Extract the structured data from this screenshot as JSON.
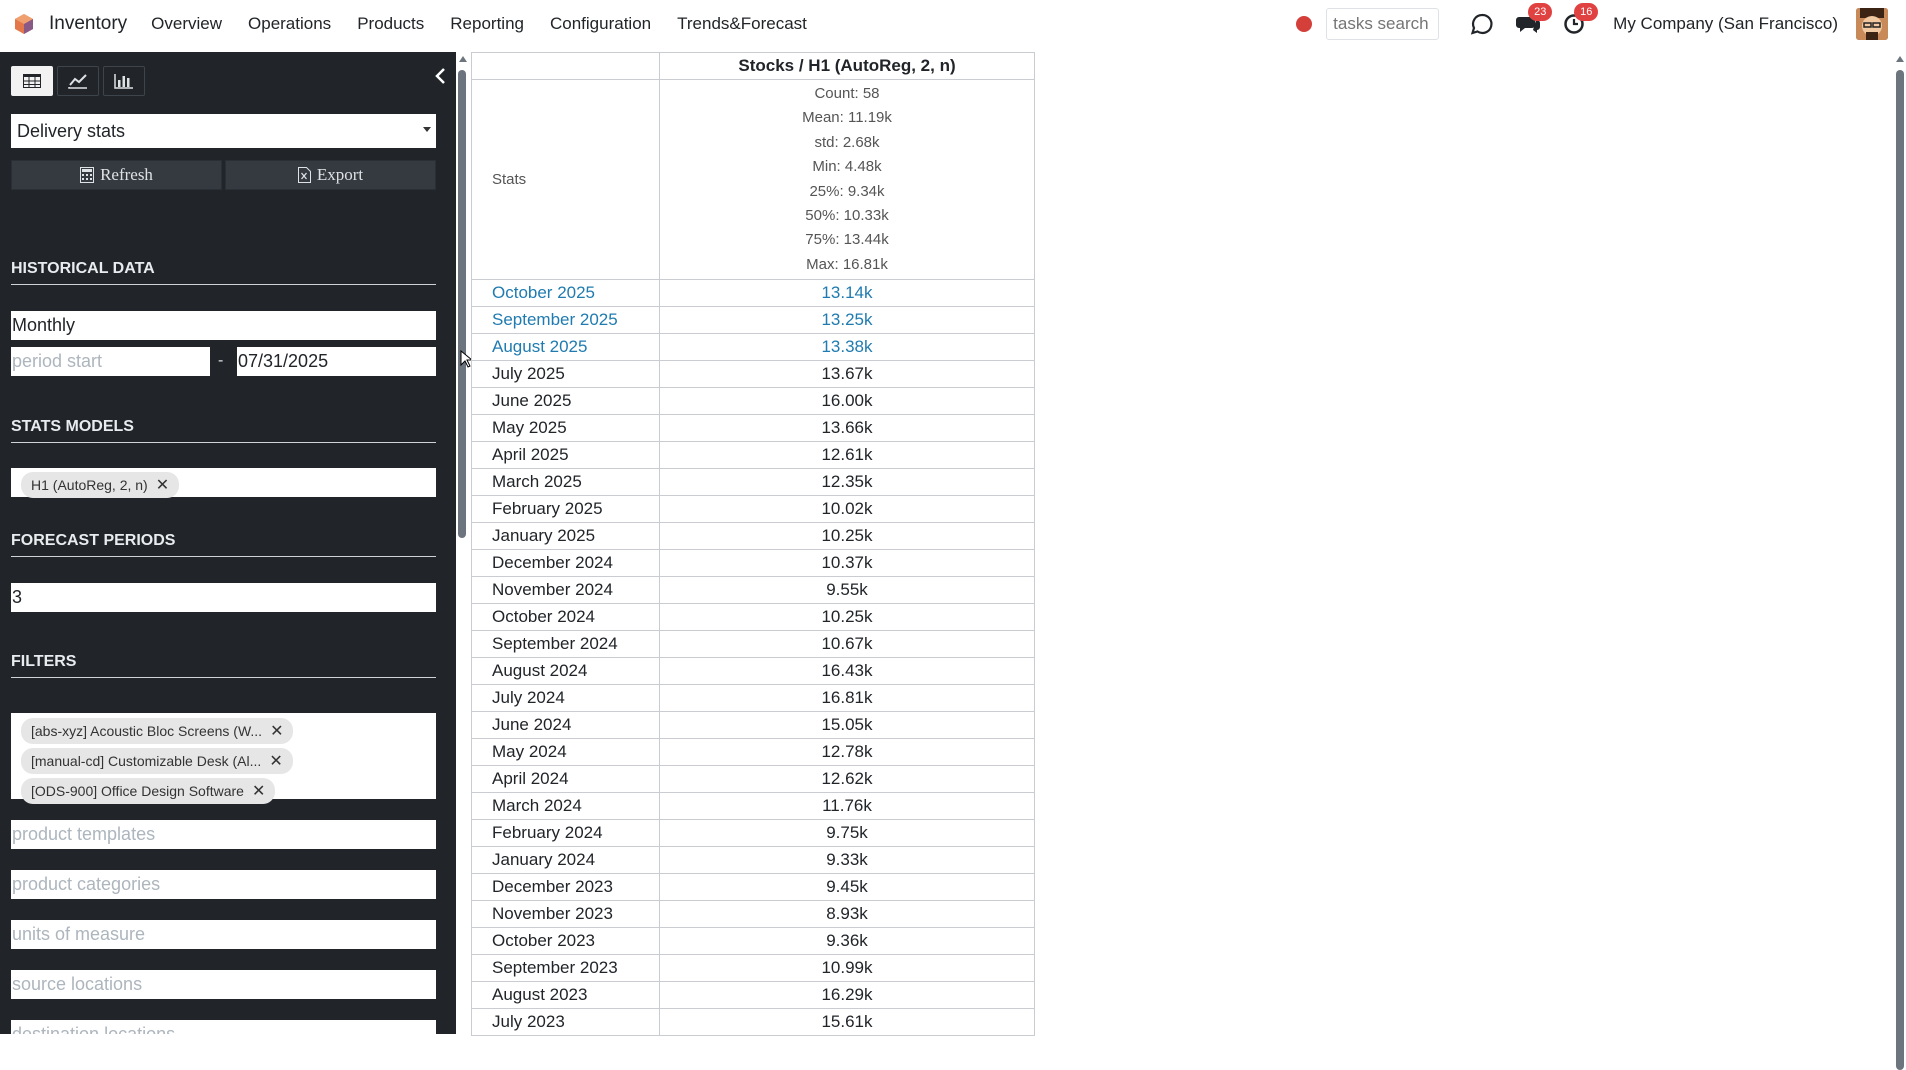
{
  "topbar": {
    "app_name": "Inventory",
    "menu": [
      "Overview",
      "Operations",
      "Products",
      "Reporting",
      "Configuration",
      "Trends&Forecast"
    ],
    "search_placeholder": "tasks search",
    "messages_count": "23",
    "activities_count": "16",
    "company": "My Company (San Francisco)",
    "colors": {
      "brand": "#e4774a",
      "record": "#d43f3a",
      "badge": "#e04141"
    }
  },
  "sidebar": {
    "view_icons": [
      "table-icon",
      "line-chart-icon",
      "bar-chart-icon"
    ],
    "report_select": "Delivery stats",
    "refresh_label": "Refresh",
    "export_label": "Export",
    "historical_title": "HISTORICAL DATA",
    "period": "Monthly",
    "period_start_placeholder": "period start",
    "period_sep": "-",
    "period_end": "07/31/2025",
    "stats_models_title": "STATS MODELS",
    "model_tag": "H1 (AutoReg, 2, n)",
    "forecast_periods_title": "FORECAST PERIODS",
    "forecast_periods": "3",
    "filters_title": "FILTERS",
    "filter_tags": [
      "[abs-xyz] Acoustic Bloc Screens (W...",
      "[manual-cd] Customizable Desk (Al...",
      "[ODS-900] Office Design Software"
    ],
    "filter_inputs": [
      "product templates",
      "product categories",
      "units of measure",
      "source locations",
      "destination locations"
    ]
  },
  "table": {
    "header": "Stocks / H1 (AutoReg, 2, n)",
    "stats_label": "Stats",
    "stats": [
      "Count: 58",
      "Mean: 11.19k",
      "std: 2.68k",
      "Min: 4.48k",
      "25%: 9.34k",
      "50%: 10.33k",
      "75%: 13.44k",
      "Max: 16.81k"
    ],
    "forecast_color": "#1f7bb0",
    "rows": [
      {
        "period": "October 2025",
        "value": "13.14k",
        "forecast": true
      },
      {
        "period": "September 2025",
        "value": "13.25k",
        "forecast": true
      },
      {
        "period": "August 2025",
        "value": "13.38k",
        "forecast": true
      },
      {
        "period": "July 2025",
        "value": "13.67k",
        "forecast": false
      },
      {
        "period": "June 2025",
        "value": "16.00k",
        "forecast": false
      },
      {
        "period": "May 2025",
        "value": "13.66k",
        "forecast": false
      },
      {
        "period": "April 2025",
        "value": "12.61k",
        "forecast": false
      },
      {
        "period": "March 2025",
        "value": "12.35k",
        "forecast": false
      },
      {
        "period": "February 2025",
        "value": "10.02k",
        "forecast": false
      },
      {
        "period": "January 2025",
        "value": "10.25k",
        "forecast": false
      },
      {
        "period": "December 2024",
        "value": "10.37k",
        "forecast": false
      },
      {
        "period": "November 2024",
        "value": "9.55k",
        "forecast": false
      },
      {
        "period": "October 2024",
        "value": "10.25k",
        "forecast": false
      },
      {
        "period": "September 2024",
        "value": "10.67k",
        "forecast": false
      },
      {
        "period": "August 2024",
        "value": "16.43k",
        "forecast": false
      },
      {
        "period": "July 2024",
        "value": "16.81k",
        "forecast": false
      },
      {
        "period": "June 2024",
        "value": "15.05k",
        "forecast": false
      },
      {
        "period": "May 2024",
        "value": "12.78k",
        "forecast": false
      },
      {
        "period": "April 2024",
        "value": "12.62k",
        "forecast": false
      },
      {
        "period": "March 2024",
        "value": "11.76k",
        "forecast": false
      },
      {
        "period": "February 2024",
        "value": "9.75k",
        "forecast": false
      },
      {
        "period": "January 2024",
        "value": "9.33k",
        "forecast": false
      },
      {
        "period": "December 2023",
        "value": "9.45k",
        "forecast": false
      },
      {
        "period": "November 2023",
        "value": "8.93k",
        "forecast": false
      },
      {
        "period": "October 2023",
        "value": "9.36k",
        "forecast": false
      },
      {
        "period": "September 2023",
        "value": "10.99k",
        "forecast": false
      },
      {
        "period": "August 2023",
        "value": "16.29k",
        "forecast": false
      },
      {
        "period": "July 2023",
        "value": "15.61k",
        "forecast": false
      }
    ]
  }
}
